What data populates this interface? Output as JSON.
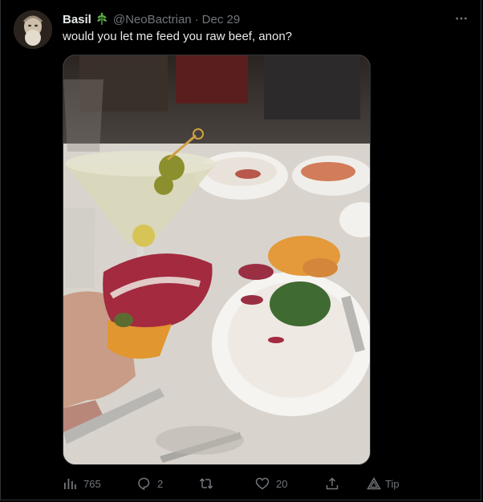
{
  "tweet": {
    "author_name": "Basil",
    "author_handle": "@NeoBactrian",
    "separator": "·",
    "date": "Dec 29",
    "text": "would you let me feed you raw beef, anon?",
    "badge_icon": "leaf-sprig-icon",
    "more_icon": "more-horizontal-icon",
    "media_alt": "photo"
  },
  "actions": {
    "views": {
      "icon": "views-bar-chart-icon",
      "count": "765"
    },
    "replies": {
      "icon": "reply-bubble-icon",
      "count": "2"
    },
    "retweets": {
      "icon": "retweet-icon",
      "count": ""
    },
    "likes": {
      "icon": "heart-icon",
      "count": "20"
    },
    "share": {
      "icon": "share-upload-icon"
    },
    "tip": {
      "icon": "tip-triangle-icon",
      "label": "Tip"
    }
  },
  "colors": {
    "background": "#000000",
    "text_primary": "#e7e9ea",
    "text_secondary": "#71767b",
    "border": "#2f3336",
    "badge_green": "#5bb04a"
  }
}
